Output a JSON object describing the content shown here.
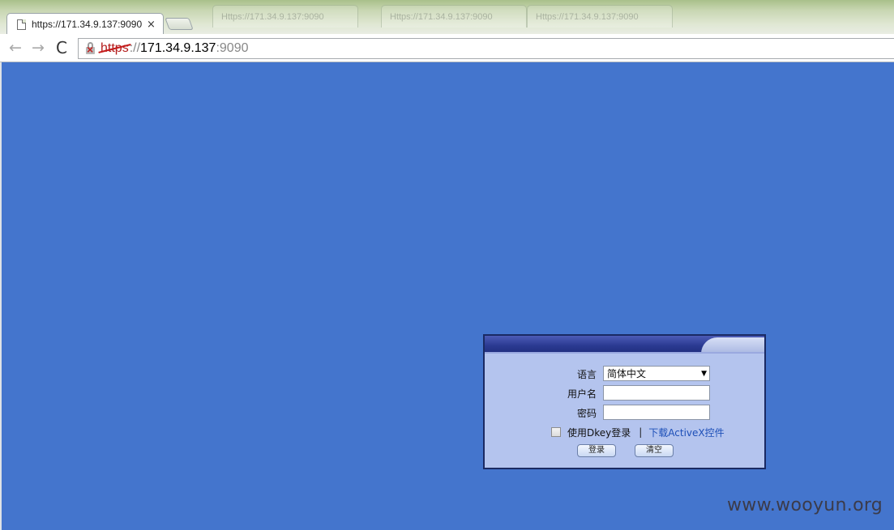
{
  "browser": {
    "background_tabs": [
      "Https://171.34.9.137:9090",
      "Https://171.34.9.137:9090",
      "Https://171.34.9.137:9090"
    ],
    "active_tab": {
      "title": "https://171.34.9.137:9090",
      "close_glyph": "×"
    },
    "toolbar": {
      "back_glyph": "←",
      "forward_glyph": "→",
      "reload_glyph": "C"
    },
    "address": {
      "scheme": "https",
      "separator": "://",
      "host": "171.34.9.137",
      "port": ":9090",
      "security_state": "certificate-error"
    }
  },
  "page": {
    "background_color": "#4475cd"
  },
  "login": {
    "language_label": "语言",
    "language_value": "简体中文",
    "username_label": "用户名",
    "username_value": "",
    "password_label": "密码",
    "password_value": "",
    "dkey_label": "使用Dkey登录",
    "divider": "|",
    "activex_link": "下载ActiveX控件",
    "login_button": "登录",
    "clear_button": "清空"
  },
  "watermark": "www.wooyun.org"
}
